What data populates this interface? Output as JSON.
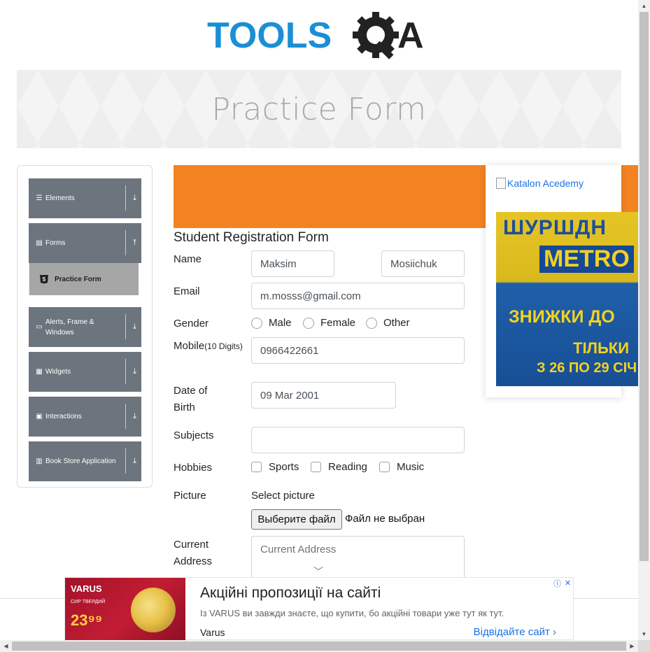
{
  "logo": {
    "text_left": "TOOLS",
    "text_right": "A",
    "brand_blue": "#1a8fd5",
    "brand_dark": "#222222"
  },
  "banner": {
    "title": "Practice Form"
  },
  "sidebar": {
    "groups": [
      {
        "label": "Elements",
        "icon": "hamburger-icon",
        "arrow": "⤓"
      },
      {
        "label": "Forms",
        "icon": "document-icon",
        "arrow": "⤒"
      },
      {
        "label": "Alerts, Frame & Windows",
        "icon": "window-icon",
        "arrow": "⤓"
      },
      {
        "label": "Widgets",
        "icon": "grid-icon",
        "arrow": "⤓"
      },
      {
        "label": "Interactions",
        "icon": "interaction-icon",
        "arrow": "⤓"
      },
      {
        "label": "Book Store Application",
        "icon": "books-icon",
        "arrow": "⤓"
      }
    ],
    "active_subitem": {
      "label": "Practice Form",
      "icon": "html5-icon",
      "badge": "5"
    }
  },
  "form": {
    "title": "Student Registration Form",
    "name_label": "Name",
    "first_name": "Maksim",
    "last_name": "Mosiichuk",
    "email_label": "Email",
    "email": "m.mosss@gmail.com",
    "gender_label": "Gender",
    "gender_options": [
      "Male",
      "Female",
      "Other"
    ],
    "mobile_label": "Mobile",
    "mobile_hint": "(10 Digits)",
    "mobile": "0966422661",
    "dob_label_1": "Date of",
    "dob_label_2": "Birth",
    "dob": "09 Mar 2001",
    "subjects_label": "Subjects",
    "subjects": "",
    "hobbies_label": "Hobbies",
    "hobbies": [
      "Sports",
      "Reading",
      "Music"
    ],
    "picture_label": "Picture",
    "select_picture": "Select picture",
    "file_button": "Выберите файл",
    "file_status": "Файл не выбран",
    "address_label_1": "Current",
    "address_label_2": "Address",
    "address_placeholder": "Current Address"
  },
  "side_ad": {
    "alt_text": "Katalon Acedemy",
    "line1": "ШУРШДН",
    "line2": "METRO",
    "line3": "ЗНИЖКИ ДО",
    "line4": "ТІЛЬКИ",
    "line5": "З 26 ПО 29 СІЧ"
  },
  "bottom_ad": {
    "brand": "VARUS",
    "price": "23⁹⁹",
    "tag": "СИР ТВЕРДИЙ",
    "headline": "Акційні пропозиції на сайті",
    "description": "Із VARUS ви завжди знаєте, що купити, бо акційні товари уже тут як тут.",
    "advertiser": "Varus",
    "cta": "Відвідайте сайт",
    "info_icon": "ⓘ",
    "close_icon": "✕"
  }
}
